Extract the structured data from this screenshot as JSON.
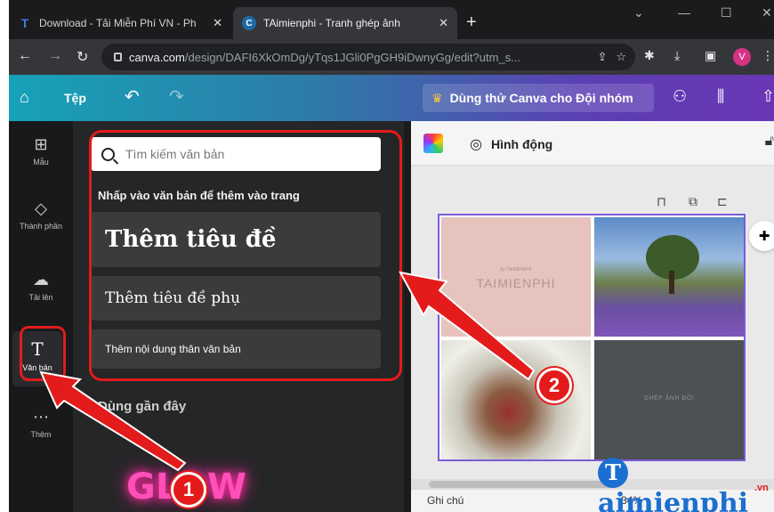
{
  "browser": {
    "tabs": [
      {
        "title": "Download - Tải Miễn Phí VN - Ph",
        "icon": "T",
        "icon_color": "#3d7be8"
      },
      {
        "title": "TAimienphi - Tranh ghép ảnh",
        "icon": "C",
        "icon_color": "#20c4cb"
      }
    ],
    "new_tab": "+",
    "url_host": "canva.com",
    "url_path": "/design/DAFI6XkOmDg/yTqs1JGli0PgGH9iDwnyGg/edit?utm_s...",
    "profile_initial": "V"
  },
  "canva_header": {
    "file_label": "Tệp",
    "trial_label": "Dùng thử Canva cho Đội nhóm"
  },
  "rail": {
    "items": [
      {
        "label": "Mẫu",
        "icon": "grid-icon"
      },
      {
        "label": "Thành phần",
        "icon": "shapes-icon"
      },
      {
        "label": "Tải lên",
        "icon": "cloud-upload-icon"
      },
      {
        "label": "Văn bản",
        "icon": "text-icon",
        "glyph": "T"
      },
      {
        "label": "Thêm",
        "icon": "more-icon"
      }
    ]
  },
  "text_panel": {
    "search_placeholder": "Tìm kiếm văn bản",
    "hint": "Nhấp vào văn bản để thêm vào trang",
    "heading": "Thêm tiêu đề",
    "subheading": "Thêm tiêu đề phụ",
    "body": "Thêm nội dung thân văn bản",
    "recent": "Dùng gần đây",
    "recent_item": "GLOW"
  },
  "editor": {
    "animate_label": "Hình động",
    "cells": {
      "c1_small": "by TAIMIENPHI",
      "c1_big": "TAIMIENPHI",
      "c4": "GHÉP ẢNH ĐÔI"
    },
    "footer_notes": "Ghi chú",
    "footer_zoom": "34%"
  },
  "annotations": {
    "step1": "1",
    "step2": "2",
    "color": "#e31b1b"
  },
  "watermark": {
    "text": "aimienphi",
    "suffix": ".vn"
  }
}
